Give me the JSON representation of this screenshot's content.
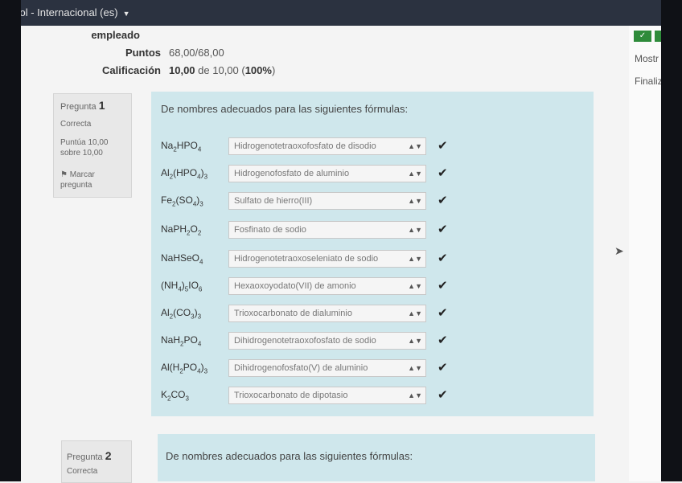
{
  "topbar": {
    "language": "añol - Internacional (es)"
  },
  "summary": {
    "row0_label": "empleado",
    "points_label": "Puntos",
    "points_value": "68,00/68,00",
    "grade_label": "Calificación",
    "grade_value_bold": "10,00",
    "grade_value_rest": " de 10,00 (",
    "grade_percent": "100%",
    "grade_close": ")"
  },
  "sidebar_right": {
    "show_label": "Mostr",
    "finish_label": "Finaliz",
    "check_symbol": "✓"
  },
  "question1": {
    "label": "Pregunta",
    "number": "1",
    "state": "Correcta",
    "score": "Puntúa 10,00 sobre 10,00",
    "flag": "Marcar pregunta",
    "prompt": "De nombres adecuados para las siguientes fórmulas:",
    "rows": [
      {
        "answer": "Hidrogenotetraoxofosfato de disodio"
      },
      {
        "answer": "Hidrogenofosfato de aluminio"
      },
      {
        "answer": "Sulfato de hierro(III)"
      },
      {
        "answer": "Fosfinato de sodio"
      },
      {
        "answer": "Hidrogenotetraoxoseleniato de sodio"
      },
      {
        "answer": "Hexaoxoyodato(VII) de amonio"
      },
      {
        "answer": "Trioxocarbonato de dialuminio"
      },
      {
        "answer": "Dihidrogenotetraoxofosfato de sodio"
      },
      {
        "answer": "Dihidrogenofosfato(V) de aluminio"
      },
      {
        "answer": "Trioxocarbonato de dipotasio"
      }
    ]
  },
  "question2": {
    "label": "Pregunta",
    "number": "2",
    "state": "Correcta",
    "prompt": "De nombres adecuados para las siguientes fórmulas:"
  },
  "icons": {
    "caret": "caret-down-icon",
    "select_arrow": "select-arrows-icon",
    "check": "check-icon",
    "flag": "flag-icon",
    "cursor": "mouse-pointer-icon"
  }
}
